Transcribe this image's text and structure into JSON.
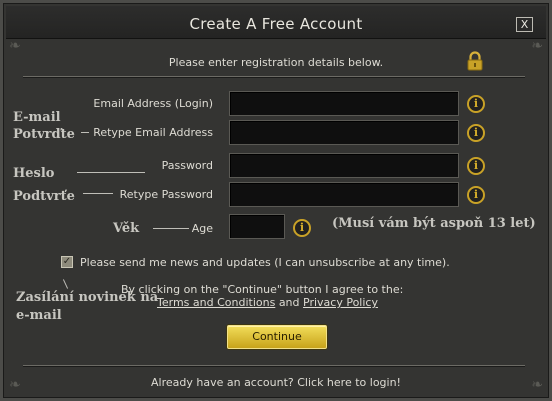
{
  "dialog": {
    "title": "Create A Free Account",
    "close_label": "X",
    "intro": "Please enter registration details below."
  },
  "form": {
    "fields": [
      {
        "label": "Email Address (Login)",
        "value": ""
      },
      {
        "label": "Retype Email Address",
        "value": ""
      },
      {
        "label": "Password",
        "value": ""
      },
      {
        "label": "Retype Password",
        "value": ""
      },
      {
        "label": "Age",
        "value": ""
      }
    ],
    "info_label": "i",
    "newsletter_checked": true,
    "newsletter_text": "Please send me news and updates (I can unsubscribe at any time).",
    "agree_text": "By clicking on the \"Continue\" button I agree to the:",
    "terms_link": "Terms and Conditions",
    "and_word": "and",
    "privacy_link": "Privacy Policy",
    "continue_label": "Continue",
    "login_link": "Already have an account? Click here to login!"
  },
  "annotations": {
    "email": "E-mail",
    "confirm": "Potvrďte",
    "password": "Heslo",
    "confirm2": "Podtvrťe",
    "age": "Věk",
    "age_note": "(Musí vám být aspoň 13 let)",
    "news1": "Zasílání novinek na",
    "news2": "e-mail"
  },
  "colors": {
    "accent": "#c9a227",
    "button": "#e2c43a",
    "background": "#343432"
  },
  "icons": {
    "lock": "padlock-icon",
    "info": "info-icon",
    "check": "checkmark-icon"
  }
}
